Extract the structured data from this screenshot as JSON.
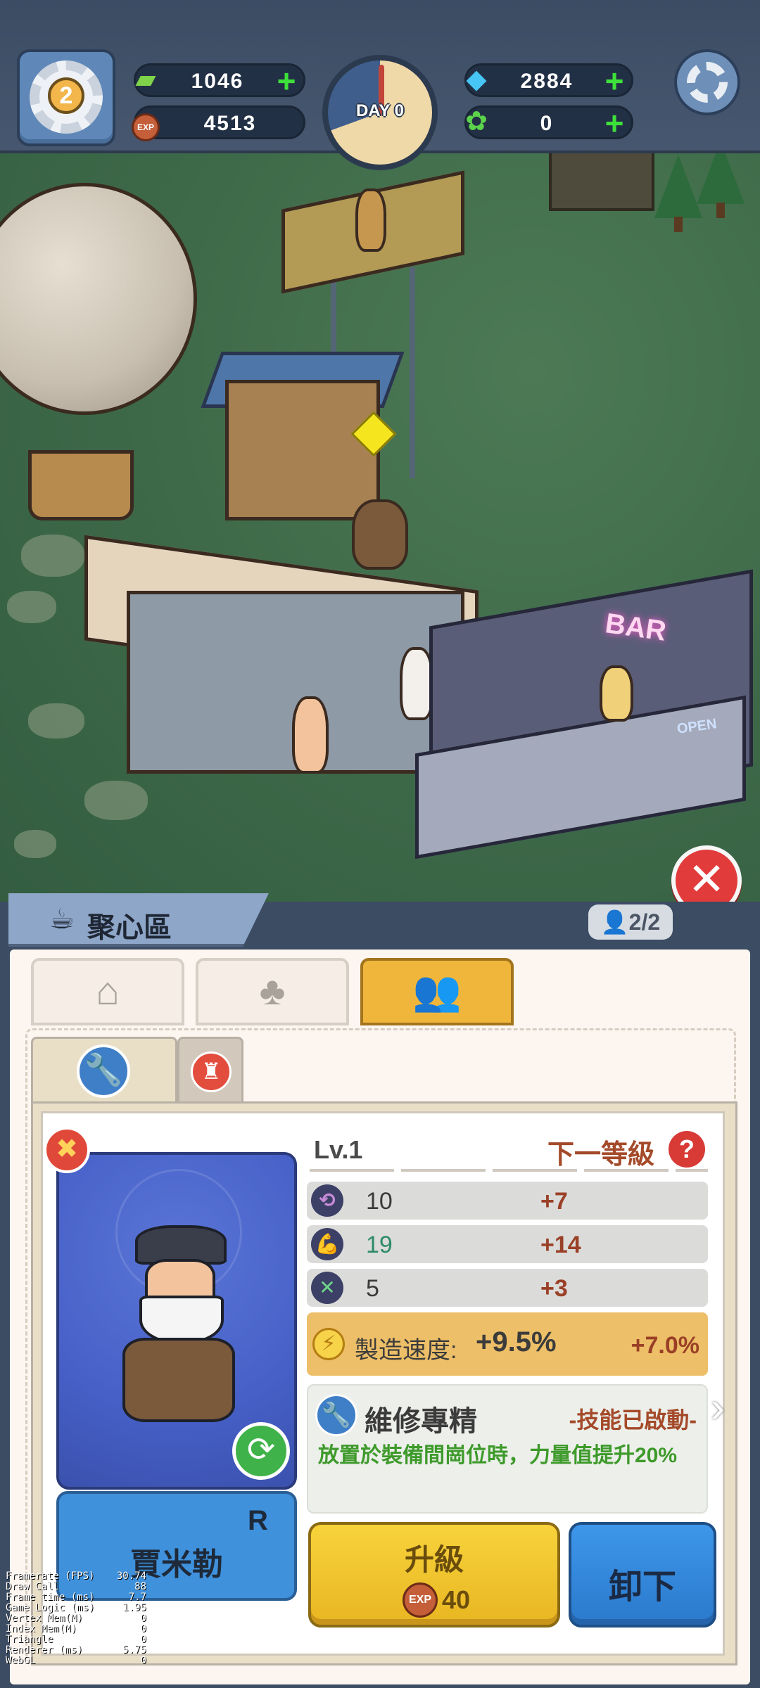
{
  "hud": {
    "player_level": "2",
    "cash": "1046",
    "exp": "4513",
    "day_label": "DAY 0",
    "gems": "2884",
    "tickets": "0",
    "exp_icon_text": "EXP"
  },
  "scene": {
    "bar_sign": "BAR",
    "open_sign": "OPEN"
  },
  "panel": {
    "area_title": "聚心區",
    "capacity": "2/2",
    "level": "Lv.1",
    "next_level_label": "下一等級",
    "help": "?",
    "stats": [
      {
        "icon": "skill-icon",
        "value": "10",
        "bonus": "+7",
        "color": "#3b3b3b"
      },
      {
        "icon": "strength-icon",
        "value": "19",
        "bonus": "+14",
        "color": "#2e8a6a"
      },
      {
        "icon": "tools-icon",
        "value": "5",
        "bonus": "+3",
        "color": "#3b3b3b"
      }
    ],
    "speed": {
      "label": "製造速度:",
      "value": "+9.5%",
      "next": "+7.0%"
    },
    "skill": {
      "name": "維修專精",
      "status": "-技能已啟動-",
      "description": "放置於裝備間崗位時，力量值提升20%"
    },
    "worker": {
      "rarity": "R",
      "name": "賈米勒"
    },
    "upgrade": {
      "label": "升級",
      "cost": "40"
    },
    "unload_label": "卸下"
  },
  "debug": [
    {
      "label": "Framerate (FPS)",
      "value": "30.74"
    },
    {
      "label": "Draw Call",
      "value": "88"
    },
    {
      "label": "Frame time (ms)",
      "value": "7.7"
    },
    {
      "label": "Game Logic (ms)",
      "value": "1.95"
    },
    {
      "label": "Vertex Mem(M)",
      "value": "0"
    },
    {
      "label": "Index Mem(M)",
      "value": "0"
    },
    {
      "label": "Triangle",
      "value": "0"
    },
    {
      "label": "Renderer (ms)",
      "value": "5.75"
    },
    {
      "label": "WebGL",
      "value": "0"
    }
  ],
  "colors": {
    "accent_gold": "#f0b63c",
    "button_blue": "#3e97ea",
    "close_red": "#e23b3b"
  }
}
